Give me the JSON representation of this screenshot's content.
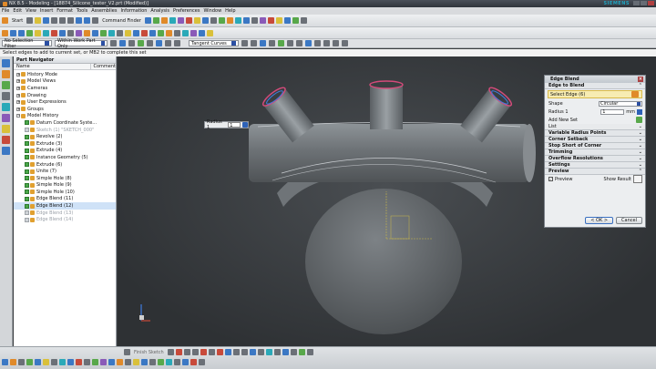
{
  "window": {
    "title": "NX 8.5 - Modeling - [18874_Silicone_tester_V2.prt (Modified)]",
    "brand": "SIEMENS"
  },
  "menu": [
    "File",
    "Edit",
    "View",
    "Insert",
    "Format",
    "Tools",
    "Assemblies",
    "Information",
    "Analysis",
    "Preferences",
    "Window",
    "Help"
  ],
  "toolbar": {
    "start_label": "Start",
    "command_finder_label": "Command Finder"
  },
  "selection_bar": {
    "filter": "No Selection Filter",
    "scope": "Within Work Part Only",
    "curve_rule": "Tangent Curves"
  },
  "prompt": "Select edges to add to current set, or MB2 to complete this set",
  "navigator": {
    "title": "Part Navigator",
    "col_name": "Name",
    "col_comment": "Comment",
    "items": [
      {
        "label": "History Mode",
        "level": 0,
        "state": "normal"
      },
      {
        "label": "Model Views",
        "level": 0,
        "state": "normal"
      },
      {
        "label": "Cameras",
        "level": 0,
        "state": "normal"
      },
      {
        "label": "Drawing",
        "level": 0,
        "state": "normal"
      },
      {
        "label": "User Expressions",
        "level": 0,
        "state": "normal"
      },
      {
        "label": "Groups",
        "level": 0,
        "state": "normal"
      },
      {
        "label": "Model History",
        "level": 0,
        "state": "normal"
      },
      {
        "label": "Datum Coordinate Syste...",
        "level": 1,
        "state": "normal"
      },
      {
        "label": "Sketch (1) \"SKETCH_000\"",
        "level": 1,
        "state": "dim"
      },
      {
        "label": "Revolve (2)",
        "level": 1,
        "state": "normal"
      },
      {
        "label": "Extrude (3)",
        "level": 1,
        "state": "normal"
      },
      {
        "label": "Extrude (4)",
        "level": 1,
        "state": "normal"
      },
      {
        "label": "Instance Geometry (5)",
        "level": 1,
        "state": "normal"
      },
      {
        "label": "Extrude (6)",
        "level": 1,
        "state": "normal"
      },
      {
        "label": "Unite (7)",
        "level": 1,
        "state": "normal"
      },
      {
        "label": "Simple Hole (8)",
        "level": 1,
        "state": "normal"
      },
      {
        "label": "Simple Hole (9)",
        "level": 1,
        "state": "normal"
      },
      {
        "label": "Simple Hole (10)",
        "level": 1,
        "state": "normal"
      },
      {
        "label": "Edge Blend (11)",
        "level": 1,
        "state": "normal"
      },
      {
        "label": "Edge Blend (12)",
        "level": 1,
        "state": "normal"
      },
      {
        "label": "Edge Blend (13)",
        "level": 1,
        "state": "dim"
      },
      {
        "label": "Edge Blend (14)",
        "level": 1,
        "state": "dim"
      }
    ]
  },
  "radius_popup": {
    "label": "Radius 1",
    "value": "1"
  },
  "dialog": {
    "title": "Edge Blend",
    "edge_to_blend": "Edge to Blend",
    "select_edge": "Select Edge (6)",
    "shape_label": "Shape",
    "shape_value": "Circular",
    "radius_label": "Radius 1",
    "radius_value": "1",
    "radius_unit": "mm",
    "add_new_set": "Add New Set",
    "list": "List",
    "sections": [
      "Variable Radius Points",
      "Corner Setback",
      "Stop Short of Corner",
      "Trimming",
      "Overflow Resolutions",
      "Settings",
      "Preview"
    ],
    "preview_check": "Preview",
    "show_result": "Show Result",
    "ok": "< OK >",
    "cancel": "Cancel"
  },
  "statusbar": {
    "sketch_label": "Finish Sketch"
  }
}
